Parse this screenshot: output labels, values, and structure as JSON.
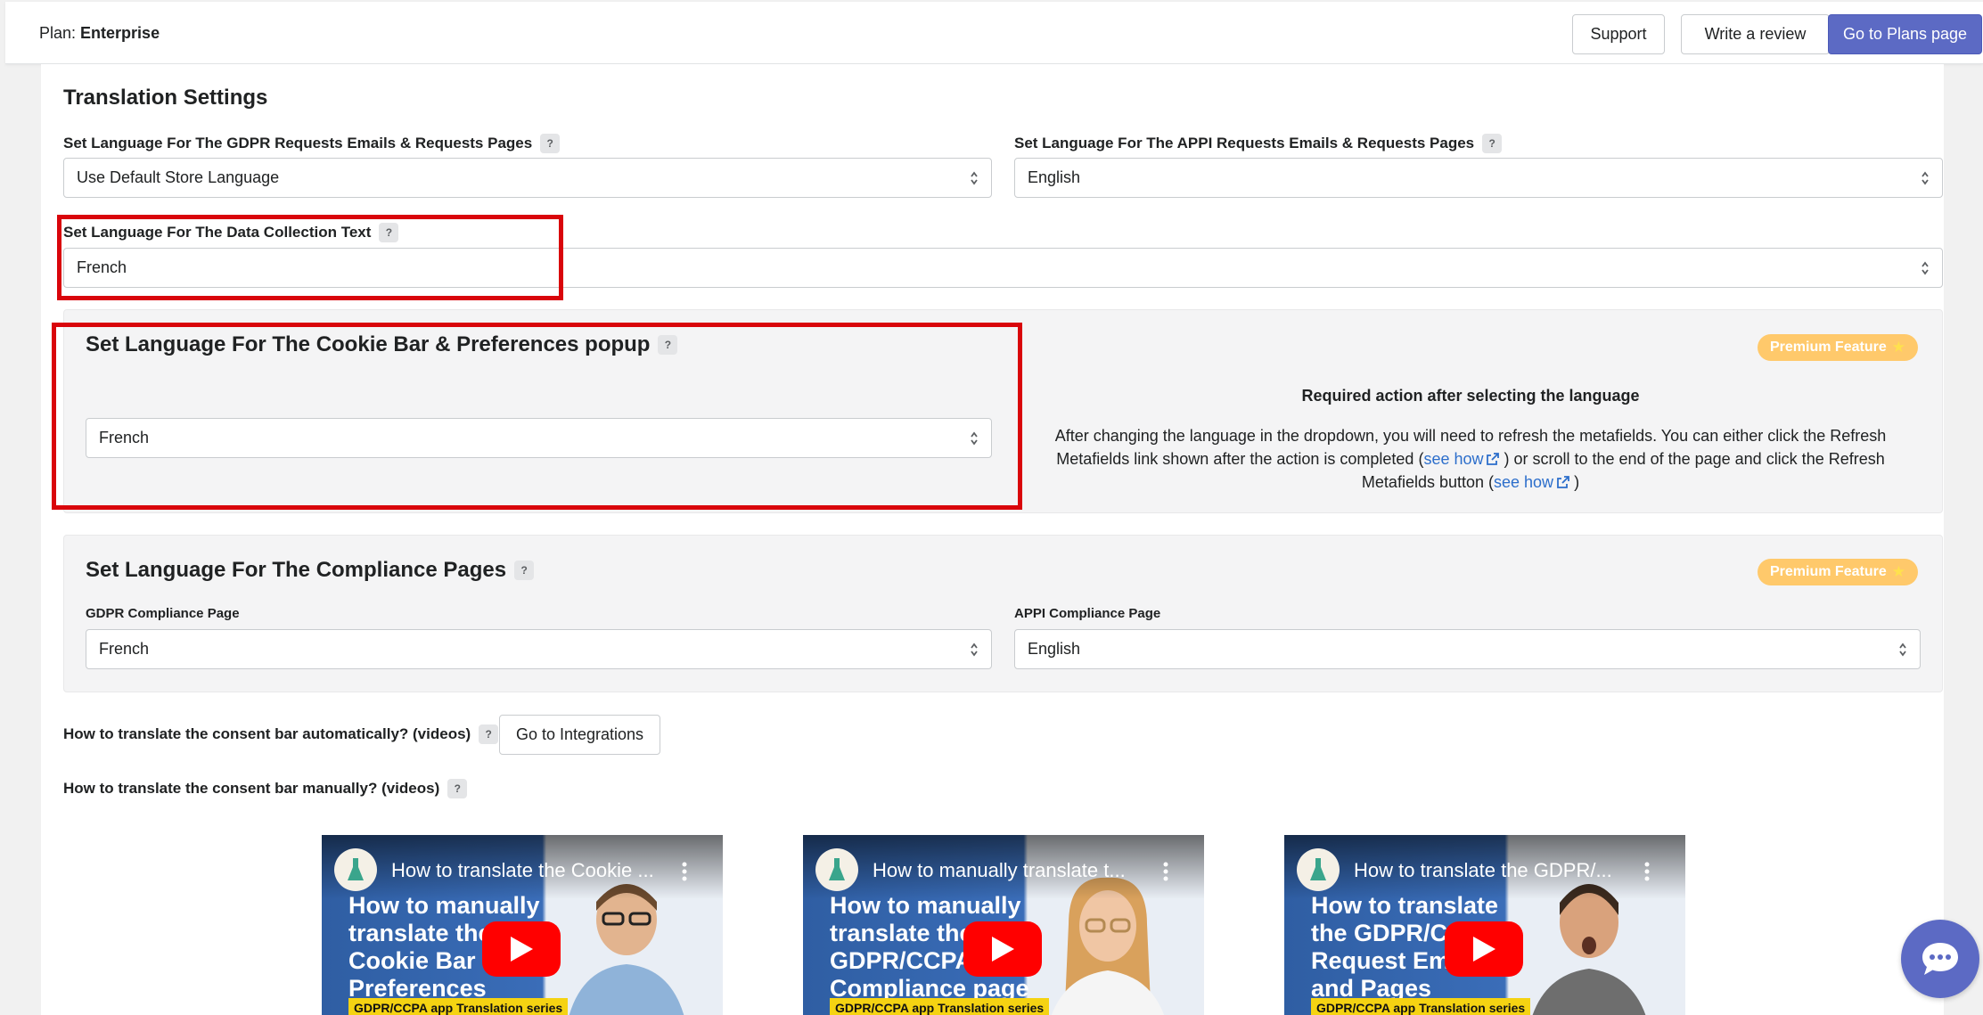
{
  "topbar": {
    "plan_prefix": "Plan:",
    "plan_name": "Enterprise",
    "support_label": "Support",
    "review_label": "Write a review",
    "plans_label": "Go to Plans page"
  },
  "translation": {
    "title": "Translation Settings",
    "gdpr_label": "Set Language For The GDPR Requests Emails & Requests Pages",
    "gdpr_value": "Use Default Store Language",
    "appi_label": "Set Language For The APPI Requests Emails & Requests Pages",
    "appi_value": "English",
    "data_collection_label": "Set Language For The Data Collection Text",
    "data_collection_value": "French"
  },
  "cookie_bar": {
    "title": "Set Language For The Cookie Bar & Preferences popup",
    "value": "French",
    "premium_label": "Premium Feature",
    "required_title": "Required action after selecting the language",
    "required_text_1": "After changing the language in the dropdown, you will need to refresh the metafields. You can either click the Refresh Metafields link shown after the action is completed (",
    "see_how_1": "see how",
    "required_text_2": ") or scroll to the end of the page and click the Refresh Metafields button (",
    "see_how_2": "see how",
    "required_text_3": ")"
  },
  "compliance": {
    "title": "Set Language For The Compliance Pages",
    "premium_label": "Premium Feature",
    "gdpr_label": "GDPR Compliance Page",
    "gdpr_value": "French",
    "appi_label": "APPI Compliance Page",
    "appi_value": "English"
  },
  "help": {
    "auto_label": "How to translate the consent bar automatically? (videos)",
    "integrations_label": "Go to Integrations",
    "manual_label": "How to translate the consent bar manually? (videos)"
  },
  "videos": [
    {
      "title": "How to translate the Cookie ...",
      "headline": "How to manually translate the Cookie Bar & Preferences Popup",
      "series": "GDPR/CCPA app Translation series"
    },
    {
      "title": "How to manually translate t...",
      "headline": "How to manually translate the GDPR/CCPA Compliance page",
      "series": "GDPR/CCPA app Translation series"
    },
    {
      "title": "How to translate the GDPR/...",
      "headline": "How to translate the GDPR/CCPA Request Emails and Pages",
      "series": "GDPR/CCPA app Translation series"
    }
  ],
  "icons": {
    "help": "question-mark-icon",
    "select": "select-arrows-icon",
    "external": "external-link-icon",
    "chat": "chat-icon",
    "play": "play-icon",
    "star": "star-icon"
  },
  "colors": {
    "primary": "#5c6ac4",
    "premium": "#ffc96b",
    "highlight": "#d9050b",
    "link": "#2c6ecb"
  }
}
